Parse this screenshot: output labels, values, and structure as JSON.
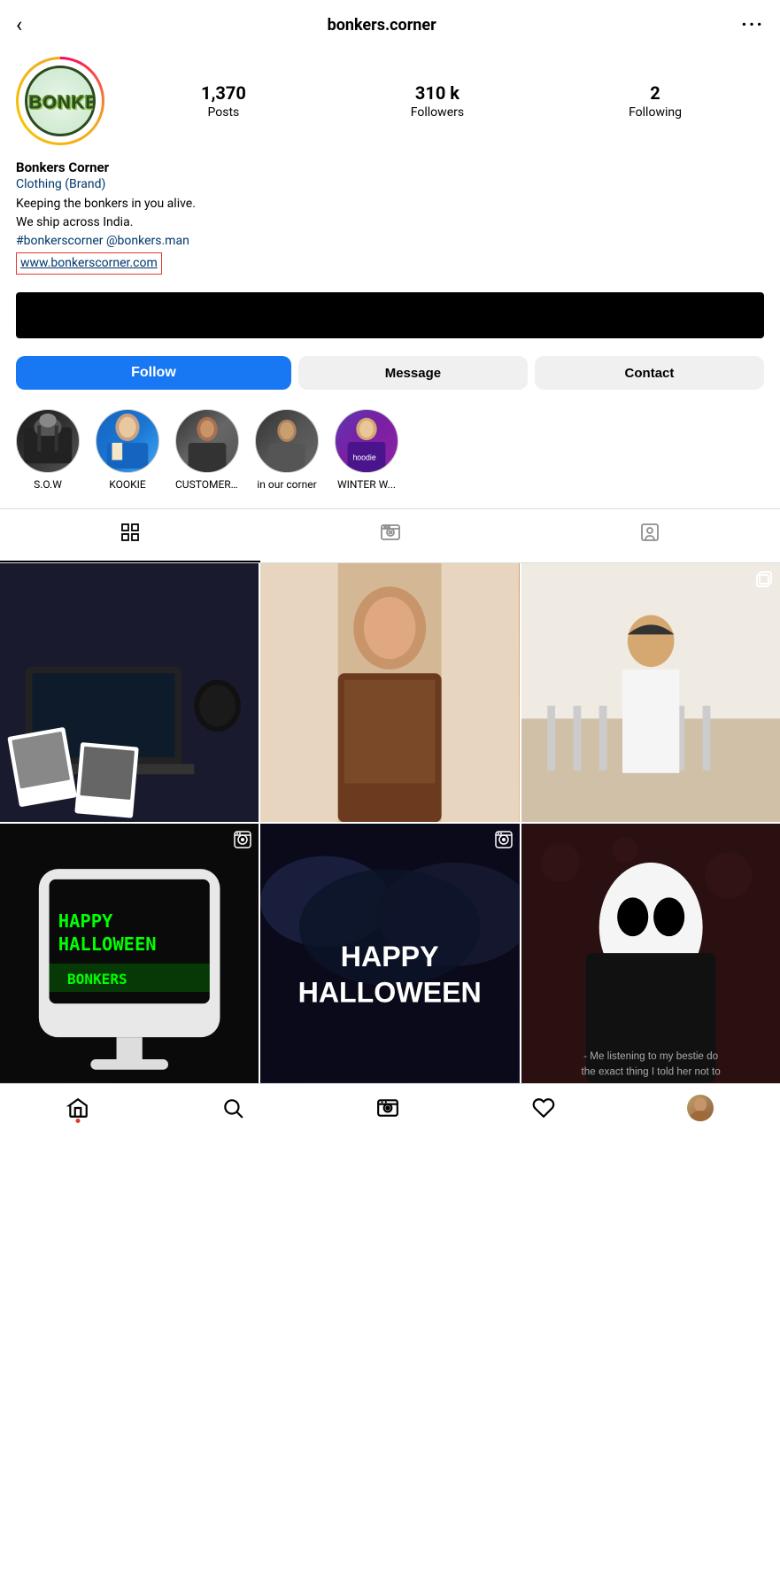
{
  "header": {
    "title": "bonkers.corner",
    "back_label": "‹",
    "more_label": "···"
  },
  "profile": {
    "username": "bonkers.corner",
    "display_name": "Bonkers Corner",
    "category": "Clothing (Brand)",
    "bio_line1": "Keeping the bonkers in you alive.",
    "bio_line2": "We ship across India.",
    "bio_hashtags": "#bonkerscorner @bonkers.man",
    "bio_link": "www.bonkerscorner.com",
    "stats": {
      "posts": {
        "count": "1,370",
        "label": "Posts"
      },
      "followers": {
        "count": "310 k",
        "label": "Followers"
      },
      "following": {
        "count": "2",
        "label": "Following"
      }
    }
  },
  "buttons": {
    "follow": "Follow",
    "message": "Message",
    "contact": "Contact"
  },
  "highlights": [
    {
      "id": "sow",
      "label": "S.O.W",
      "color_class": "hl-sow"
    },
    {
      "id": "kookie",
      "label": "KOOKIE",
      "color_class": "hl-kookie"
    },
    {
      "id": "customer",
      "label": "CUSTOMER...",
      "color_class": "hl-customer"
    },
    {
      "id": "corner",
      "label": "in our corner",
      "color_class": "hl-corner"
    },
    {
      "id": "winter",
      "label": "WINTER W...",
      "color_class": "hl-winter"
    }
  ],
  "tabs": [
    {
      "id": "grid",
      "label": "Grid",
      "active": true
    },
    {
      "id": "reels",
      "label": "Reels",
      "active": false
    },
    {
      "id": "tagged",
      "label": "Tagged",
      "active": false
    }
  ],
  "grid": [
    {
      "id": 1,
      "type": "photo",
      "color": "cell-1",
      "badge": ""
    },
    {
      "id": 2,
      "type": "photo",
      "color": "cell-2",
      "badge": ""
    },
    {
      "id": 3,
      "type": "multi",
      "color": "cell-3",
      "badge": "multi"
    },
    {
      "id": 4,
      "type": "reel",
      "color": "cell-4",
      "badge": "reel",
      "text": "HAPPY HALLOWEEN BONKERS"
    },
    {
      "id": 5,
      "type": "reel",
      "color": "cell-5",
      "badge": "reel",
      "text": "HAPPY HALLOWEEN"
    },
    {
      "id": 6,
      "type": "photo",
      "color": "cell-6",
      "badge": ""
    }
  ],
  "bottom_nav": {
    "items": [
      {
        "id": "home",
        "icon": "home",
        "active": true
      },
      {
        "id": "search",
        "icon": "search",
        "active": false
      },
      {
        "id": "reels",
        "icon": "reels",
        "active": false
      },
      {
        "id": "heart",
        "icon": "heart",
        "active": false
      },
      {
        "id": "profile",
        "icon": "avatar",
        "active": false
      }
    ]
  }
}
